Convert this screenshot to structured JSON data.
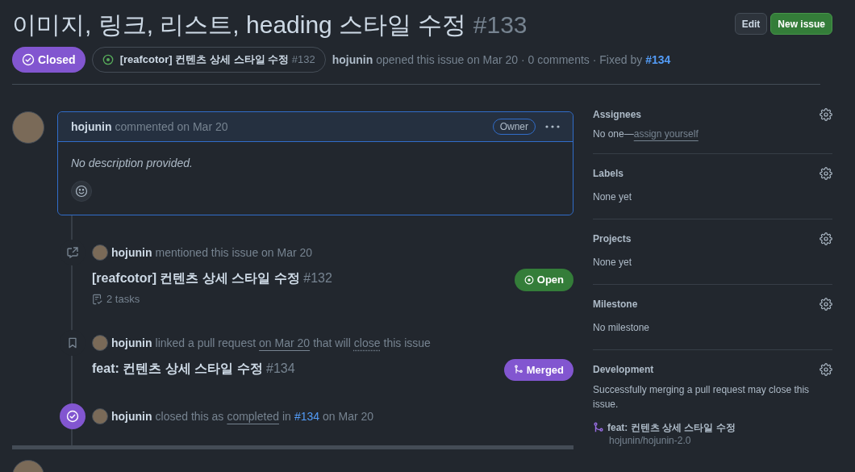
{
  "header": {
    "title": "이미지, 링크, 리스트, heading 스타일 수정",
    "number": "#133",
    "buttons": [
      {
        "label": "Edit",
        "kind": "default"
      },
      {
        "label": "New issue",
        "kind": "primary"
      }
    ]
  },
  "status": {
    "kind": "closed",
    "label": "Closed"
  },
  "linked_issue": {
    "kind": "open",
    "title": "[reafcotor] 컨텐츠 상세 스타일 수정",
    "number": "#132"
  },
  "meta": {
    "author": "hojunin",
    "text": "opened this issue on Mar 20 · 0 comments · Fixed by",
    "link": "#134"
  },
  "comment": {
    "author": "hojunin",
    "action": "commented on Mar 20",
    "badge": "Owner",
    "body": "No description provided."
  },
  "timeline": [
    {
      "kind": "mention",
      "author": "hojunin",
      "parts": [
        {
          "text": "mentioned this issue on Mar 20",
          "kind": "plain"
        }
      ],
      "ref": {
        "title": "[reafcotor] 컨텐츠 상세 스타일 수정",
        "number": "#132",
        "tasks": "2 tasks",
        "badge": {
          "kind": "open",
          "label": "Open"
        }
      }
    },
    {
      "kind": "link",
      "author": "hojunin",
      "parts": [
        {
          "text": "linked a pull request",
          "kind": "plain"
        },
        {
          "text": "on Mar 20",
          "kind": "underline"
        },
        {
          "text": "that will",
          "kind": "plain"
        },
        {
          "text": "close",
          "kind": "dotted"
        },
        {
          "text": "this issue",
          "kind": "plain"
        }
      ],
      "ref": {
        "title": "feat: 컨텐츠 상세 스타일 수정",
        "number": "#134",
        "badge": {
          "kind": "merged",
          "label": "Merged"
        }
      }
    },
    {
      "kind": "closed",
      "author": "hojunin",
      "parts": [
        {
          "text": "closed this as",
          "kind": "plain"
        },
        {
          "text": "completed",
          "kind": "underline"
        },
        {
          "text": "in",
          "kind": "plain"
        },
        {
          "text": "#134",
          "kind": "blue"
        },
        {
          "text": "on Mar 20",
          "kind": "plain"
        }
      ]
    }
  ],
  "sidebar": [
    {
      "kind": "assignees",
      "title": "Assignees",
      "value": "No one—",
      "link": "assign yourself"
    },
    {
      "kind": "plain",
      "title": "Labels",
      "value": "None yet"
    },
    {
      "kind": "plain",
      "title": "Projects",
      "value": "None yet"
    },
    {
      "kind": "plain",
      "title": "Milestone",
      "value": "No milestone"
    },
    {
      "kind": "development",
      "title": "Development",
      "value": "Successfully merging a pull request may close this issue.",
      "pr": {
        "title": "feat: 컨텐츠 상세 스타일 수정",
        "repo": "hojunin/hojunin-2.0"
      }
    }
  ]
}
